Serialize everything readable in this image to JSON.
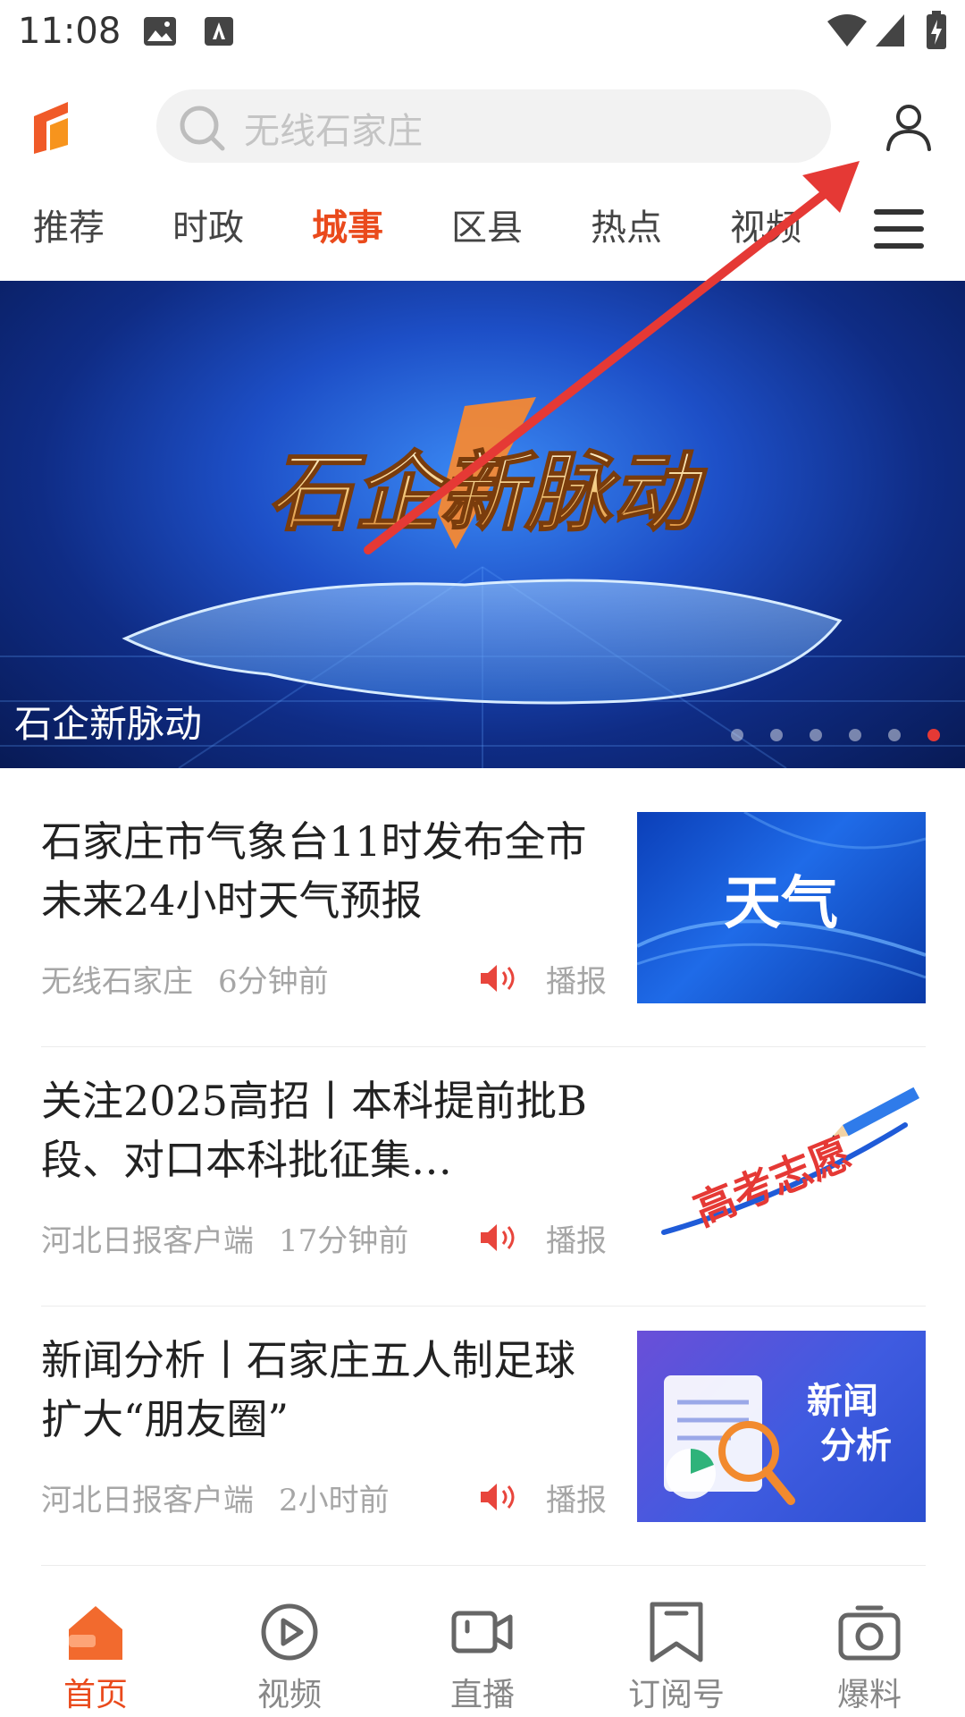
{
  "status": {
    "time": "11:08"
  },
  "search": {
    "placeholder": "无线石家庄"
  },
  "tabs": [
    {
      "label": "推荐",
      "active": false
    },
    {
      "label": "时政",
      "active": false
    },
    {
      "label": "城事",
      "active": true
    },
    {
      "label": "区县",
      "active": false
    },
    {
      "label": "热点",
      "active": false
    },
    {
      "label": "视频",
      "active": false
    }
  ],
  "banner": {
    "art_text": "石企新脉动",
    "caption": "石企新脉动",
    "slide_count": 6,
    "active_slide": 6
  },
  "news": [
    {
      "title": "石家庄市气象台11时发布全市未来24小时天气预报",
      "source": "无线石家庄",
      "time": "6分钟前",
      "play_label": "播报",
      "thumb_text": "天气"
    },
    {
      "title": "关注2025高招丨本科提前批B段、对口本科批征集…",
      "source": "河北日报客户端",
      "time": "17分钟前",
      "play_label": "播报",
      "thumb_text": "高考志愿"
    },
    {
      "title": "新闻分析丨石家庄五人制足球扩大“朋友圈”",
      "source": "河北日报客户端",
      "time": "2小时前",
      "play_label": "播报",
      "thumb_text_1": "新闻",
      "thumb_text_2": "分析"
    }
  ],
  "nav": [
    {
      "label": "首页",
      "active": true
    },
    {
      "label": "视频",
      "active": false
    },
    {
      "label": "直播",
      "active": false
    },
    {
      "label": "订阅号",
      "active": false
    },
    {
      "label": "爆料",
      "active": false
    }
  ],
  "colors": {
    "accent": "#ea4a1c",
    "arrow": "#e53935",
    "muted": "#a6a6a6"
  }
}
